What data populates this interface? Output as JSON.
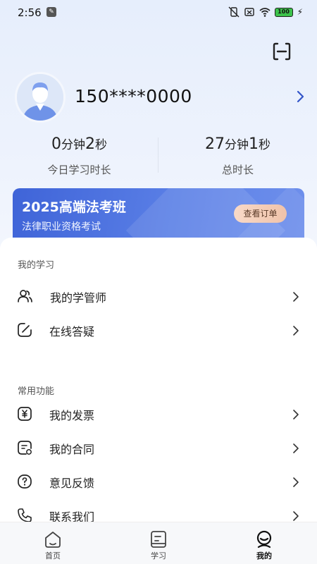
{
  "status_bar": {
    "time": "2:56",
    "battery": "100"
  },
  "profile": {
    "phone": "150****0000"
  },
  "stats": {
    "today": {
      "value_num1": "0",
      "unit1": "分钟",
      "value_num2": "2",
      "unit2": "秒",
      "label": "今日学习时长"
    },
    "total": {
      "value_num1": "27",
      "unit1": "分钟",
      "value_num2": "1",
      "unit2": "秒",
      "label": "总时长"
    }
  },
  "banner": {
    "title": "2025高端法考班",
    "subtitle": "法律职业资格考试",
    "button": "查看订单"
  },
  "my_study": {
    "title": "我的学习",
    "items": [
      {
        "label": "我的学管师",
        "icon": "users-icon"
      },
      {
        "label": "在线答疑",
        "icon": "edit-icon"
      }
    ]
  },
  "common_functions": {
    "title": "常用功能",
    "items": [
      {
        "label": "我的发票",
        "icon": "yen-invoice-icon"
      },
      {
        "label": "我的合同",
        "icon": "contract-icon"
      },
      {
        "label": "意见反馈",
        "icon": "question-icon"
      },
      {
        "label": "联系我们",
        "icon": "phone-icon"
      }
    ]
  },
  "bottom_nav": {
    "items": [
      {
        "label": "首页",
        "icon": "home-icon",
        "active": false
      },
      {
        "label": "学习",
        "icon": "book-icon",
        "active": false
      },
      {
        "label": "我的",
        "icon": "profile-icon",
        "active": true
      }
    ]
  },
  "colors": {
    "accent": "#3f64d8",
    "banner_button": "#f0c3aa",
    "arrow_blue": "#3355c8"
  }
}
